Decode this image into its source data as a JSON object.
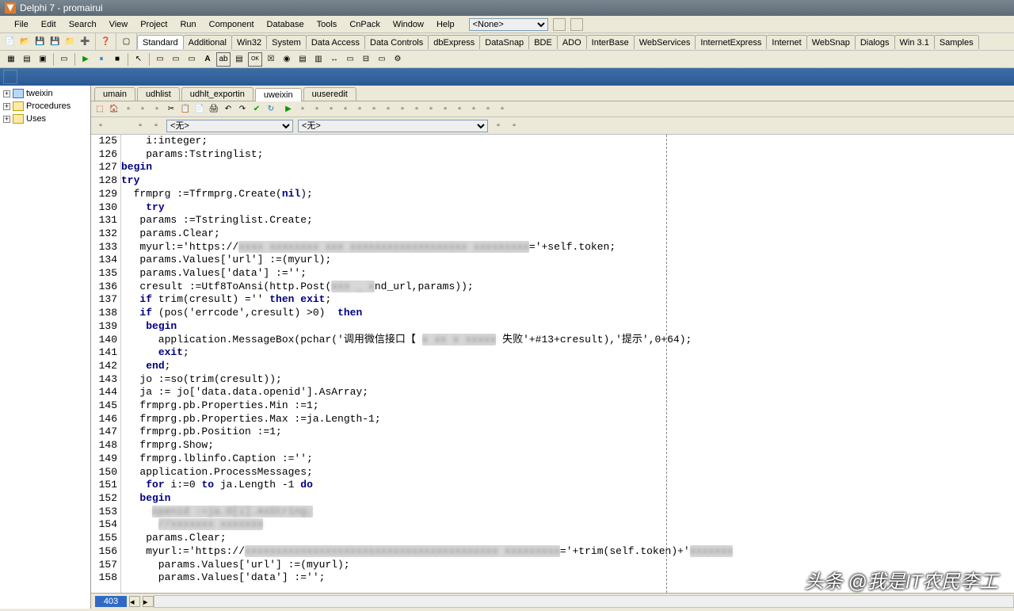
{
  "title": "Delphi 7 - promairui",
  "menus": [
    "File",
    "Edit",
    "Search",
    "View",
    "Project",
    "Run",
    "Component",
    "Database",
    "Tools",
    "CnPack",
    "Window",
    "Help"
  ],
  "combo_none": "<None>",
  "palette_tabs": [
    "Standard",
    "Additional",
    "Win32",
    "System",
    "Data Access",
    "Data Controls",
    "dbExpress",
    "DataSnap",
    "BDE",
    "ADO",
    "InterBase",
    "WebServices",
    "InternetExpress",
    "Internet",
    "WebSnap",
    "Dialogs",
    "Win 3.1",
    "Samples"
  ],
  "palette_active": 0,
  "tree": {
    "items": [
      {
        "label": "tweixin",
        "leaf": true
      },
      {
        "label": "Procedures",
        "leaf": false
      },
      {
        "label": "Uses",
        "leaf": false
      }
    ]
  },
  "file_tabs": [
    "umain",
    "udhlist",
    "udhlt_exportin",
    "uweixin",
    "uuseredit"
  ],
  "file_active": 3,
  "editor_combo1": "<无>",
  "editor_combo2": "<无>",
  "first_line": 125,
  "code_lines": [
    {
      "indent": "    ",
      "tokens": [
        {
          "t": "i:integer;"
        }
      ]
    },
    {
      "indent": "    ",
      "tokens": [
        {
          "t": "params:Tstringlist;"
        }
      ]
    },
    {
      "indent": "",
      "tokens": [
        {
          "t": "begin",
          "c": "kw"
        }
      ]
    },
    {
      "indent": "",
      "tokens": [
        {
          "t": "try",
          "c": "kw"
        }
      ]
    },
    {
      "indent": "  ",
      "tokens": [
        {
          "t": "frmprg :=Tfrmprg.Create("
        },
        {
          "t": "nil",
          "c": "kw"
        },
        {
          "t": ");"
        }
      ]
    },
    {
      "indent": "    ",
      "tokens": [
        {
          "t": "try",
          "c": "kw"
        }
      ]
    },
    {
      "indent": "   ",
      "tokens": [
        {
          "t": "params :=Tstringlist.Create;"
        }
      ]
    },
    {
      "indent": "   ",
      "tokens": [
        {
          "t": "params.Clear;"
        }
      ]
    },
    {
      "indent": "   ",
      "tokens": [
        {
          "t": "myurl:='https://"
        },
        {
          "t": "xxxx xxxxxxxx xxx xxxxxxxxxxxxxxxxxxx xxxxxxxxx",
          "c": "blur"
        },
        {
          "t": "='+self.token;"
        }
      ]
    },
    {
      "indent": "   ",
      "tokens": [
        {
          "t": "params.Values['url'] :=(myurl);"
        }
      ]
    },
    {
      "indent": "   ",
      "tokens": [
        {
          "t": "params.Values['data'] :='';"
        }
      ]
    },
    {
      "indent": "   ",
      "tokens": [
        {
          "t": "cresult :=Utf8ToAnsi(http.Post("
        },
        {
          "t": "xxx _ x",
          "c": "blur"
        },
        {
          "t": "nd_url,params));"
        }
      ]
    },
    {
      "indent": "   ",
      "tokens": [
        {
          "t": "if",
          "c": "kw"
        },
        {
          "t": " trim(cresult) ='' "
        },
        {
          "t": "then",
          "c": "kw"
        },
        {
          "t": " "
        },
        {
          "t": "exit",
          "c": "kw"
        },
        {
          "t": ";"
        }
      ]
    },
    {
      "indent": "   ",
      "tokens": [
        {
          "t": "if",
          "c": "kw"
        },
        {
          "t": " (pos('errcode',cresult) >0)  "
        },
        {
          "t": "then",
          "c": "kw"
        }
      ]
    },
    {
      "indent": "    ",
      "tokens": [
        {
          "t": "begin",
          "c": "kw"
        }
      ]
    },
    {
      "indent": "      ",
      "tokens": [
        {
          "t": "application.MessageBox(pchar('调用微信接口【 "
        },
        {
          "t": "x xx x xxxxx",
          "c": "blur"
        },
        {
          "t": " 失败'+#13+cresult),'提示',0+64);"
        }
      ]
    },
    {
      "indent": "      ",
      "tokens": [
        {
          "t": "exit",
          "c": "kw"
        },
        {
          "t": ";"
        }
      ]
    },
    {
      "indent": "    ",
      "tokens": [
        {
          "t": "end",
          "c": "kw"
        },
        {
          "t": ";"
        }
      ]
    },
    {
      "indent": "   ",
      "tokens": [
        {
          "t": "jo :=so(trim(cresult));"
        }
      ]
    },
    {
      "indent": "   ",
      "tokens": [
        {
          "t": "ja := jo['data.data.openid'].AsArray;"
        }
      ]
    },
    {
      "indent": "   ",
      "tokens": [
        {
          "t": "frmprg.pb.Properties.Min :=1;"
        }
      ]
    },
    {
      "indent": "   ",
      "tokens": [
        {
          "t": "frmprg.pb.Properties.Max :=ja.Length-1;"
        }
      ]
    },
    {
      "indent": "   ",
      "tokens": [
        {
          "t": "frmprg.pb.Position :=1;"
        }
      ]
    },
    {
      "indent": "   ",
      "tokens": [
        {
          "t": "frmprg.Show;"
        }
      ]
    },
    {
      "indent": "   ",
      "tokens": [
        {
          "t": "frmprg.lblinfo.Caption :='';"
        }
      ]
    },
    {
      "indent": "   ",
      "tokens": [
        {
          "t": "application.ProcessMessages;"
        }
      ]
    },
    {
      "indent": "    ",
      "tokens": [
        {
          "t": "for",
          "c": "kw"
        },
        {
          "t": " i:=0 "
        },
        {
          "t": "to",
          "c": "kw"
        },
        {
          "t": " ja.Length -1 "
        },
        {
          "t": "do",
          "c": "kw"
        }
      ]
    },
    {
      "indent": "   ",
      "tokens": [
        {
          "t": "begin",
          "c": "kw"
        }
      ]
    },
    {
      "indent": "     ",
      "tokens": [
        {
          "t": "openid :=ja.O[i].AsString;",
          "c": "blur"
        }
      ]
    },
    {
      "indent": "      ",
      "tokens": [
        {
          "t": "//xxxxxxx xxxxxxx",
          "c": "blur"
        }
      ]
    },
    {
      "indent": "    ",
      "tokens": [
        {
          "t": "params.Clear;"
        }
      ]
    },
    {
      "indent": "    ",
      "tokens": [
        {
          "t": "myurl:='https://"
        },
        {
          "t": "xxxxxxxxxxxxxxxxxxxxxxxxxxxxxxxxxxxxxxxxx xxxxxxxxx",
          "c": "blur"
        },
        {
          "t": "='+trim(self.token)+'"
        },
        {
          "t": "xxxxxxx",
          "c": "blur"
        }
      ]
    },
    {
      "indent": "      ",
      "tokens": [
        {
          "t": "params.Values['url'] :=(myurl);"
        }
      ]
    },
    {
      "indent": "      ",
      "tokens": [
        {
          "t": "params.Values['data'] :='';"
        }
      ]
    }
  ],
  "status_line": "403",
  "watermark": "头条 @我是IT农民李工"
}
